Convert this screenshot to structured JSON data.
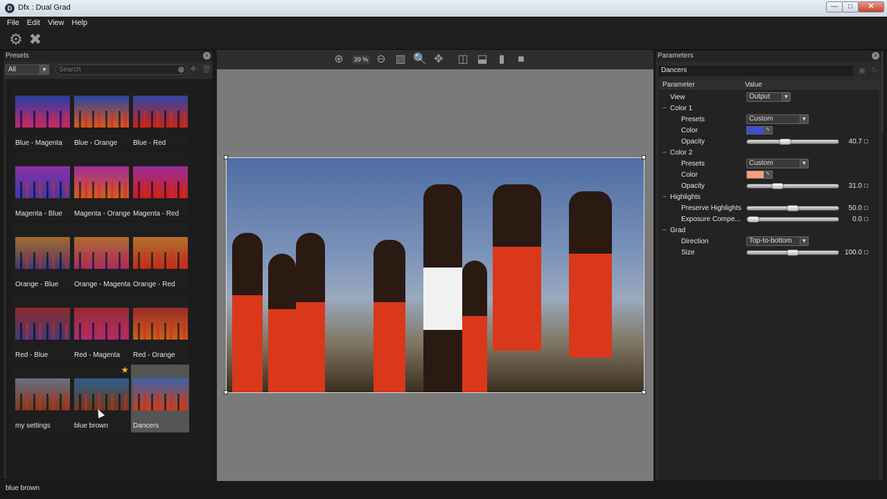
{
  "window": {
    "title": "Dfx : Dual Grad",
    "buttons": {
      "minimize": "—",
      "maximize": "□",
      "close": "✕"
    }
  },
  "menu": [
    "File",
    "Edit",
    "View",
    "Help"
  ],
  "presets_panel": {
    "title": "Presets",
    "filter": "All",
    "search_placeholder": "Search",
    "tiles": [
      {
        "label": "Blue - Magenta",
        "top": "#2b3d9c",
        "bottom": "#c02a7a"
      },
      {
        "label": "Blue - Orange",
        "top": "#2d44a0",
        "bottom": "#d75a1e"
      },
      {
        "label": "Blue - Red",
        "top": "#2f45a6",
        "bottom": "#c4261c"
      },
      {
        "label": "Magenta - Blue",
        "top": "#8e2fa6",
        "bottom": "#3b3ca8"
      },
      {
        "label": "Magenta - Orange",
        "top": "#9e2d9a",
        "bottom": "#d35f1d"
      },
      {
        "label": "Magenta - Red",
        "top": "#9a2c96",
        "bottom": "#c8211f"
      },
      {
        "label": "Orange - Blue",
        "top": "#a66a2a",
        "bottom": "#3c3a7a"
      },
      {
        "label": "Orange - Magenta",
        "top": "#b36a2b",
        "bottom": "#9c2f6e"
      },
      {
        "label": "Orange - Red",
        "top": "#b4702c",
        "bottom": "#b5301d"
      },
      {
        "label": "Red - Blue",
        "top": "#8f2a2a",
        "bottom": "#3b3c86"
      },
      {
        "label": "Red - Magenta",
        "top": "#9b2a2e",
        "bottom": "#a22f7c"
      },
      {
        "label": "Red - Orange",
        "top": "#9a2b27",
        "bottom": "#c9601f"
      },
      {
        "label": "my settings",
        "top": "#6b6f7e",
        "bottom": "#7a3a1f"
      },
      {
        "label": "blue brown",
        "top": "#2d5e8a",
        "bottom": "#6b3a1c",
        "starred": true
      },
      {
        "label": "Dancers",
        "top": "#3f62a8",
        "bottom": "#c4431f",
        "selected": true
      }
    ]
  },
  "status": "blue brown",
  "viewer": {
    "zoom": "39 %"
  },
  "parameters_panel": {
    "title": "Parameters",
    "preset_name": "Dancers",
    "columns": [
      "Parameter",
      "Value"
    ],
    "rows": [
      {
        "type": "select",
        "name": "View",
        "value": "Output",
        "small": true,
        "indent": 1
      },
      {
        "type": "group",
        "name": "Color 1"
      },
      {
        "type": "select",
        "name": "Presets",
        "value": "Custom",
        "indent": 2
      },
      {
        "type": "color",
        "name": "Color",
        "color": "#3d4fd8",
        "indent": 2
      },
      {
        "type": "slider",
        "name": "Opacity",
        "value": "40.7",
        "pos": 0.407,
        "indent": 2
      },
      {
        "type": "group",
        "name": "Color 2"
      },
      {
        "type": "select",
        "name": "Presets",
        "value": "Custom",
        "indent": 2
      },
      {
        "type": "color",
        "name": "Color",
        "color": "#f5a07a",
        "indent": 2
      },
      {
        "type": "slider",
        "name": "Opacity",
        "value": "31.0",
        "pos": 0.31,
        "indent": 2
      },
      {
        "type": "group",
        "name": "Highlights"
      },
      {
        "type": "slider",
        "name": "Preserve Highlights",
        "value": "50.0",
        "pos": 0.5,
        "indent": 2
      },
      {
        "type": "slider",
        "name": "Exposure Compe...",
        "value": "0.0",
        "pos": 0.0,
        "indent": 2
      },
      {
        "type": "group",
        "name": "Grad"
      },
      {
        "type": "select",
        "name": "Direction",
        "value": "Top-to-bottom",
        "indent": 2
      },
      {
        "type": "slider",
        "name": "Size",
        "value": "100.0",
        "pos": 0.5,
        "indent": 2
      }
    ]
  }
}
